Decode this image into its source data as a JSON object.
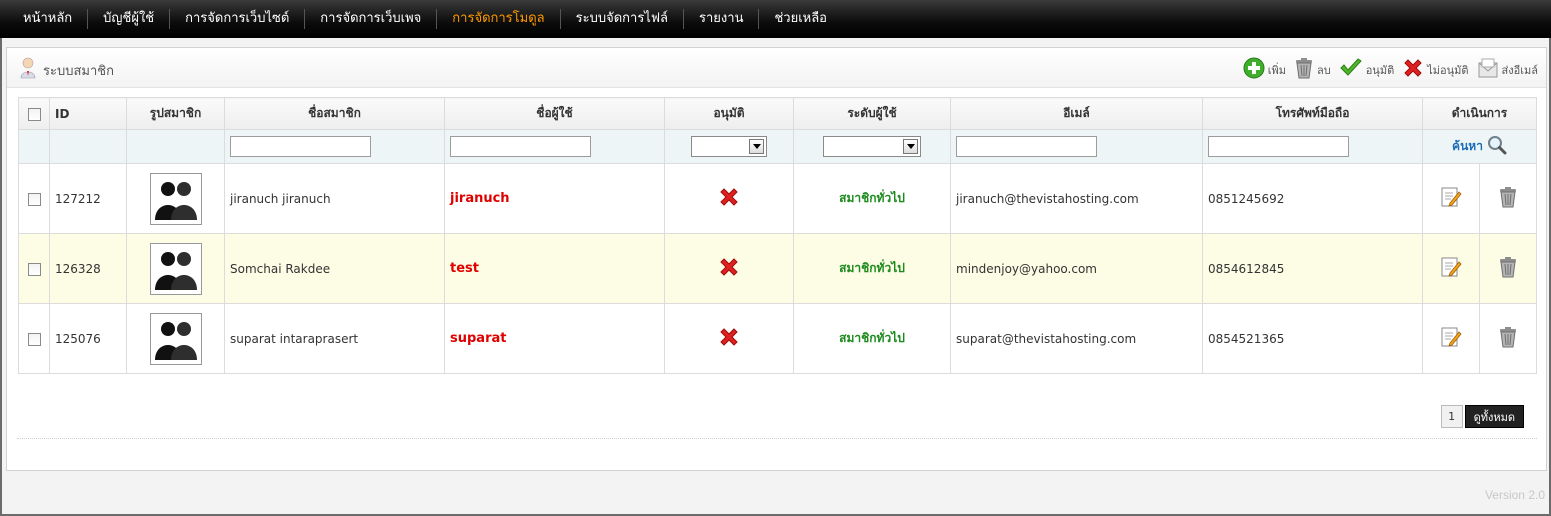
{
  "nav": [
    {
      "label": "หน้าหลัก",
      "active": false
    },
    {
      "label": "บัญชีผู้ใช้",
      "active": false
    },
    {
      "label": "การจัดการเว็บไซต์",
      "active": false
    },
    {
      "label": "การจัดการเว็บเพจ",
      "active": false
    },
    {
      "label": "การจัดการโมดูล",
      "active": true
    },
    {
      "label": "ระบบจัดการไฟล์",
      "active": false
    },
    {
      "label": "รายงาน",
      "active": false
    },
    {
      "label": "ช่วยเหลือ",
      "active": false
    }
  ],
  "panel": {
    "title": "ระบบสมาชิก",
    "toolbar": {
      "add": "เพิ่ม",
      "delete": "ลบ",
      "approve": "อนุมัติ",
      "disapprove": "ไม่อนุมัติ",
      "send_email": "ส่งอีเมล์"
    }
  },
  "table": {
    "headers": {
      "id": "ID",
      "photo": "รูปสมาชิก",
      "name": "ชื่อสมาชิก",
      "username": "ชื่อผู้ใช้",
      "approve": "อนุมัติ",
      "level": "ระดับผู้ใช้",
      "email": "อีเมล์",
      "phone": "โทรศัพท์มือถือ",
      "action": "ดำเนินการ"
    },
    "search_label": "ค้นหา",
    "rows": [
      {
        "id": "127212",
        "name": "jiranuch  jiranuch",
        "username": "jiranuch",
        "level": "สมาชิกทั่วไป",
        "email": "jiranuch@thevistahosting.com",
        "phone": "0851245692",
        "approved": false
      },
      {
        "id": "126328",
        "name": "Somchai  Rakdee",
        "username": "test",
        "level": "สมาชิกทั่วไป",
        "email": "mindenjoy@yahoo.com",
        "phone": "0854612845",
        "approved": false
      },
      {
        "id": "125076",
        "name": "suparat  intaraprasert",
        "username": "suparat",
        "level": "สมาชิกทั่วไป",
        "email": "suparat@thevistahosting.com",
        "phone": "0854521365",
        "approved": false
      }
    ]
  },
  "pager": {
    "page": "1",
    "view_all": "ดูทั้งหมด"
  },
  "footer": {
    "version": "Version 2.0"
  },
  "colors": {
    "accent": "#ff9900",
    "username": "#e00000",
    "level": "#1c8a1c",
    "search": "#1b6eb8"
  }
}
